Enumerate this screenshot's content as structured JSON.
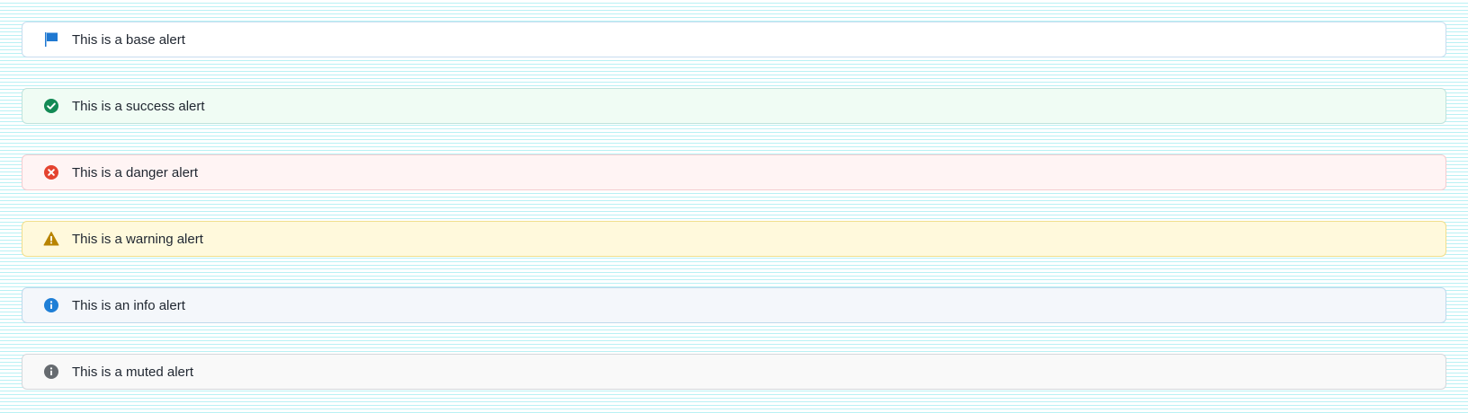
{
  "alerts": [
    {
      "variant": "base",
      "icon": "flag-icon",
      "color": "#1f78d1",
      "text": "This is a base alert"
    },
    {
      "variant": "success",
      "icon": "check-circle-icon",
      "color": "#138a55",
      "text": "This is a success alert"
    },
    {
      "variant": "danger",
      "icon": "x-circle-icon",
      "color": "#e4432f",
      "text": "This is a danger alert"
    },
    {
      "variant": "warning",
      "icon": "warning-triangle-icon",
      "color": "#b88400",
      "text": "This is a warning alert"
    },
    {
      "variant": "info",
      "icon": "info-circle-icon",
      "color": "#1f7fd6",
      "text": "This is an info alert"
    },
    {
      "variant": "muted",
      "icon": "info-circle-icon",
      "color": "#666b70",
      "text": "This is a muted alert"
    }
  ]
}
